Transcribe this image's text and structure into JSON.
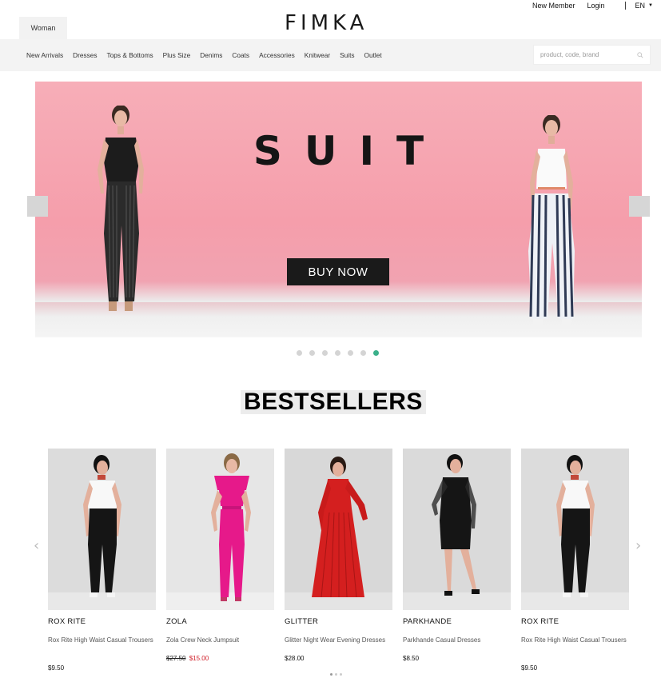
{
  "header": {
    "tab_woman": "Woman",
    "logo": "FIMKA",
    "new_member": "New Member",
    "login": "Login",
    "language": "EN"
  },
  "nav": {
    "items": [
      "New Arrivals",
      "Dresses",
      "Tops & Bottoms",
      "Plus Size",
      "Denims",
      "Coats",
      "Accessories",
      "Knitwear",
      "Suits",
      "Outlet"
    ],
    "search_placeholder": "product, code, brand"
  },
  "hero": {
    "title": "SUIT",
    "button": "BUY NOW",
    "slide_count": 7,
    "active_slide": 7
  },
  "bestsellers": {
    "title": "BESTSELLERS",
    "products": [
      {
        "brand": "ROX RITE",
        "name": "Rox Rite High Waist Casual Trousers",
        "price": "$9.50"
      },
      {
        "brand": "ZOLA",
        "name": "Zola Crew Neck Jumpsuit",
        "old_price": "$27.50",
        "new_price": "$15.00"
      },
      {
        "brand": "GLITTER",
        "name": "Glitter Night Wear Evening Dresses",
        "price": "$28.00"
      },
      {
        "brand": "PARKHANDE",
        "name": "Parkhande Casual Dresses",
        "price": "$8.50"
      },
      {
        "brand": "ROX RITE",
        "name": "Rox Rite High Waist Casual Trousers",
        "price": "$9.50"
      }
    ]
  },
  "colors": {
    "nav_bg": "#f3f3f3",
    "hero_pink": "#f59eab",
    "active_dot": "#3ab08a",
    "sale_red": "#d0202a"
  }
}
